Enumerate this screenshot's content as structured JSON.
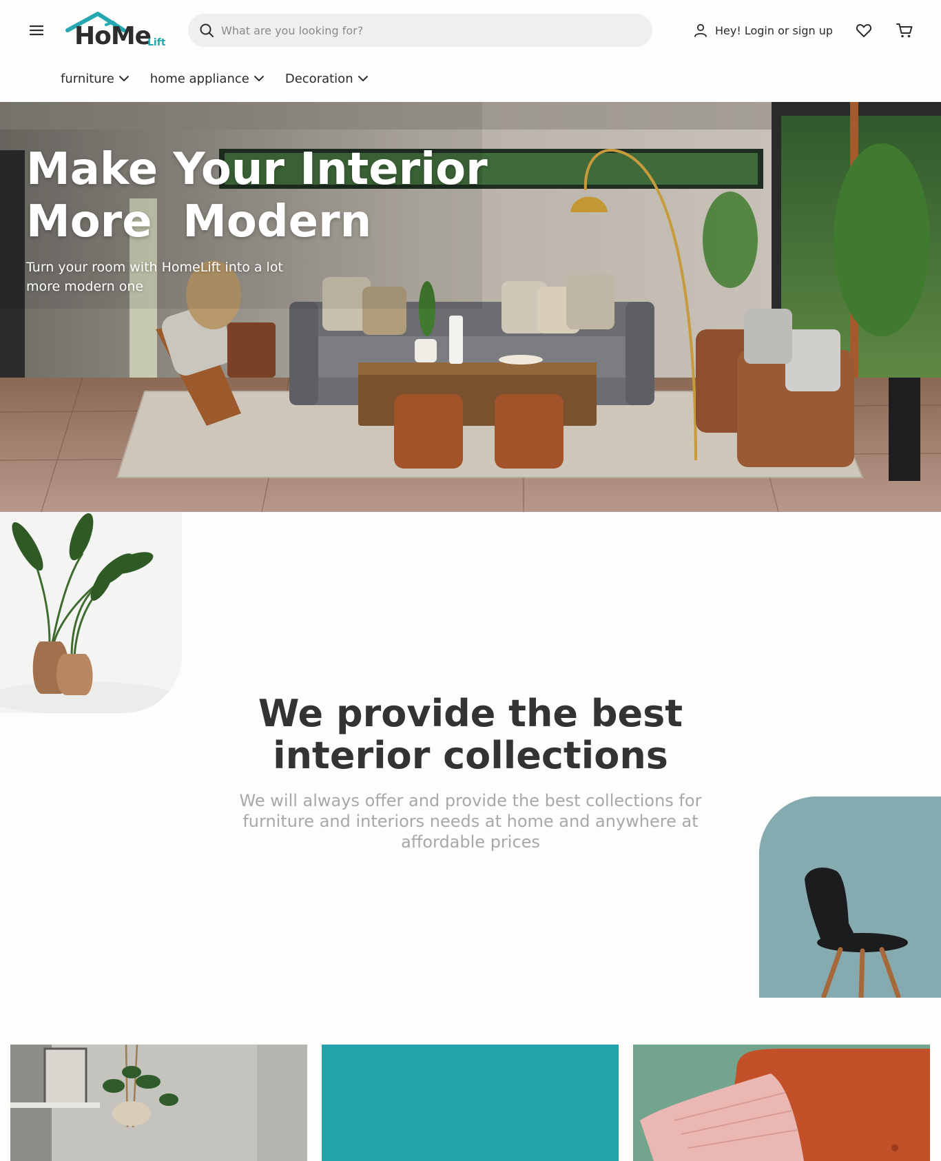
{
  "brand": {
    "logo_word": "HoMe",
    "logo_sub": "Lift",
    "accent_color": "#25a7b0"
  },
  "header": {
    "menu_icon": "hamburger-menu-icon",
    "search": {
      "placeholder": "What are you looking for?",
      "icon": "search-icon"
    },
    "account_label": "Hey! Login or sign up",
    "account_icon": "user-icon",
    "wishlist_icon": "heart-icon",
    "cart_icon": "cart-icon"
  },
  "categories": [
    {
      "label": "furniture",
      "icon": "chevron-down-icon"
    },
    {
      "label": "home appliance",
      "icon": "chevron-down-icon"
    },
    {
      "label": "Decoration",
      "icon": "chevron-down-icon"
    }
  ],
  "hero": {
    "title_line1": "Make Your Interior",
    "title_line2": "More  Modern",
    "subtitle": "Turn your room with HomeLift into a lot more modern one"
  },
  "intro": {
    "title": "We provide the best interior collections",
    "text": "We will always offer and provide the best collections for furniture and interiors needs at home and anywhere at affordable prices"
  }
}
